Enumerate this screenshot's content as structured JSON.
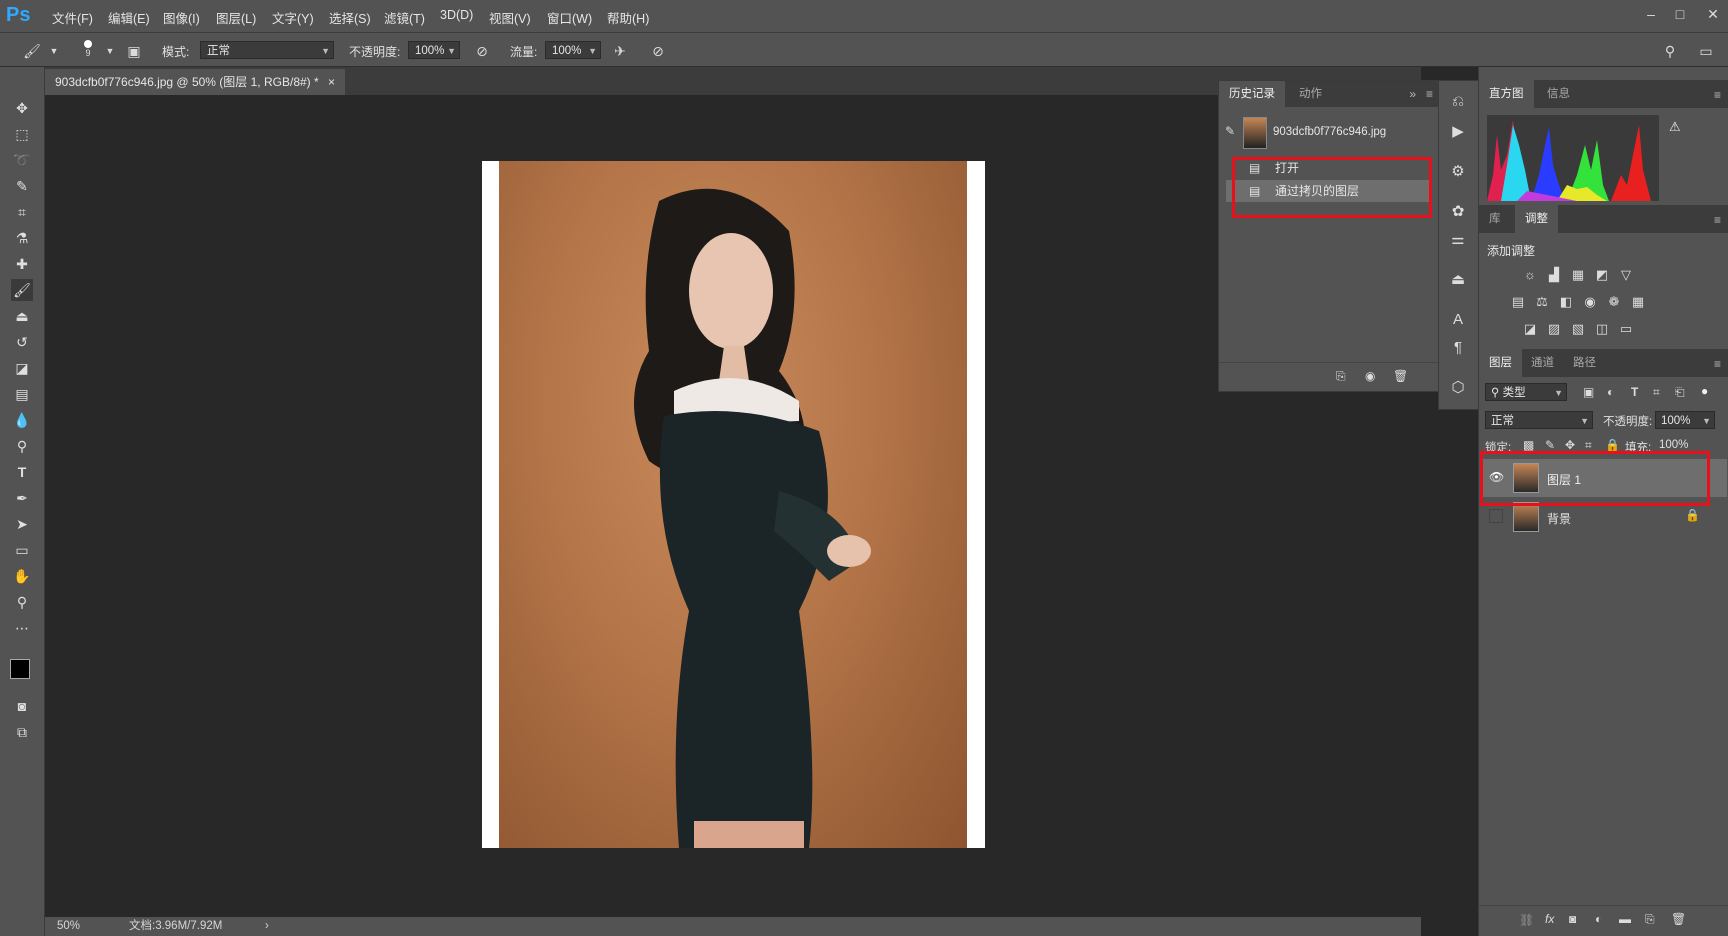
{
  "app": {
    "logo": "Ps"
  },
  "menu": [
    "文件(F)",
    "编辑(E)",
    "图像(I)",
    "图层(L)",
    "文字(Y)",
    "选择(S)",
    "滤镜(T)",
    "3D(D)",
    "视图(V)",
    "窗口(W)",
    "帮助(H)"
  ],
  "window_controls": {
    "minimize": "–",
    "maximize": "□",
    "close": "✕"
  },
  "options": {
    "brush_size": "9",
    "mode_label": "模式:",
    "mode_value": "正常",
    "opacity_label": "不透明度:",
    "opacity_value": "100%",
    "flow_label": "流量:",
    "flow_value": "100%"
  },
  "document": {
    "tab_title": "903dcfb0f776c946.jpg @ 50% (图层 1, RGB/8#) *",
    "tab_close": "×"
  },
  "status": {
    "zoom": "50%",
    "doc_size": "文档:3.96M/7.92M",
    "arrow": "›"
  },
  "history_panel": {
    "tabs": [
      "历史记录",
      "动作"
    ],
    "snapshot_name": "903dcfb0f776c946.jpg",
    "steps": [
      "打开",
      "通过拷贝的图层"
    ]
  },
  "histogram_panel": {
    "tabs": [
      "直方图",
      "信息"
    ],
    "warning": "⚠"
  },
  "adjustments_panel": {
    "tabs": [
      "库",
      "调整"
    ],
    "title": "添加调整"
  },
  "layers_panel": {
    "tabs": [
      "图层",
      "通道",
      "路径"
    ],
    "filter_label": "类型",
    "blend_mode": "正常",
    "opacity_label": "不透明度:",
    "opacity_value": "100%",
    "lock_label": "锁定:",
    "fill_label": "填充:",
    "fill_value": "100%",
    "layers": [
      {
        "name": "图层 1",
        "visible": true,
        "selected": true
      },
      {
        "name": "背景",
        "visible": false,
        "locked": true
      }
    ]
  },
  "colors": {
    "highlight_box": "#e8101a",
    "ps_blue": "#31a8ff"
  }
}
